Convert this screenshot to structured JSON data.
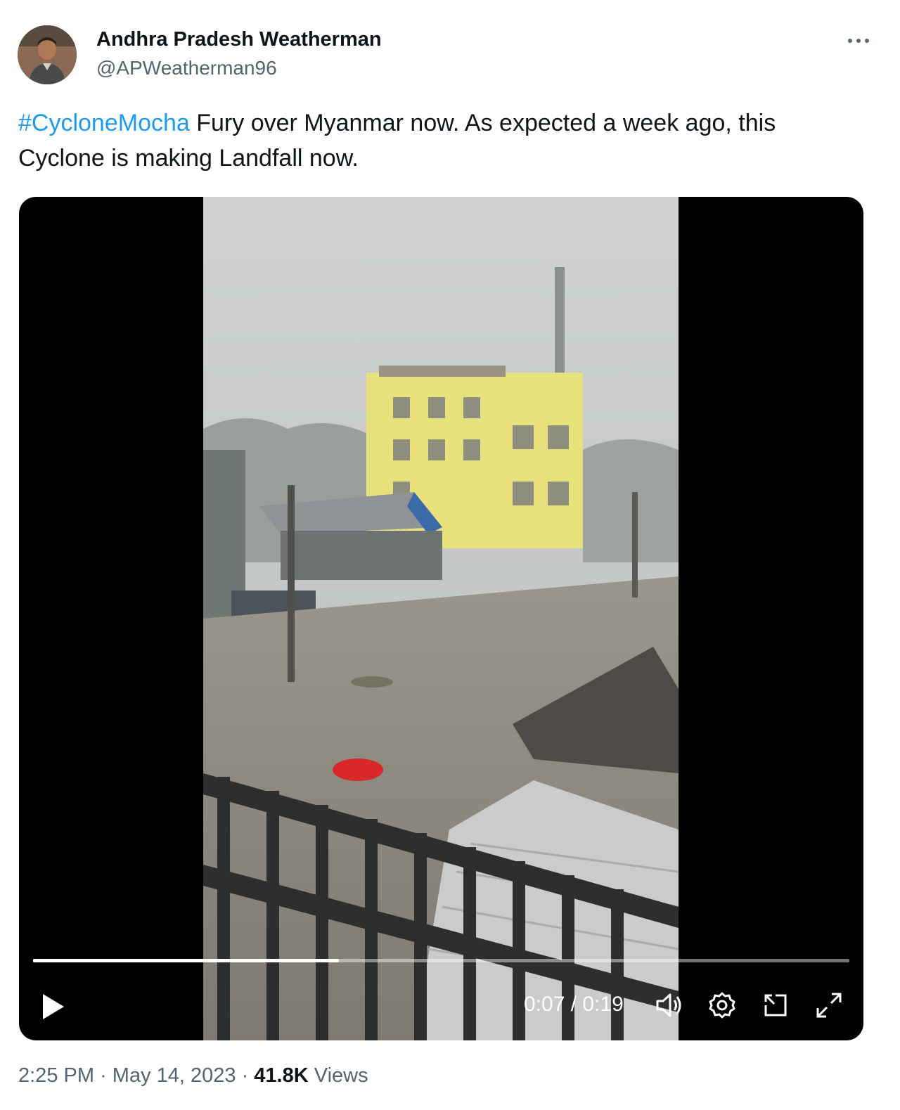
{
  "author": {
    "display_name": "Andhra Pradesh Weatherman",
    "handle": "@APWeatherman96"
  },
  "tweet": {
    "hashtag": "#CycloneMocha",
    "text": " Fury over Myanmar now. As expected a week ago, this Cyclone is making Landfall now."
  },
  "video": {
    "current_time": "0:07",
    "separator": " / ",
    "duration": "0:19",
    "progress_fraction": 0.375
  },
  "meta": {
    "time": "2:25 PM",
    "dot1": " · ",
    "date": "May 14, 2023",
    "dot2": " · ",
    "views_count": "41.8K",
    "views_label": " Views"
  },
  "icons": {
    "more": "more-horizontal-icon",
    "play": "play-icon",
    "volume": "volume-icon",
    "settings": "settings-gear-icon",
    "pip": "picture-in-picture-icon",
    "fullscreen": "fullscreen-icon"
  },
  "colors": {
    "link": "#1d9bf0",
    "secondary_text": "#536471",
    "primary_text": "#0f1419"
  }
}
